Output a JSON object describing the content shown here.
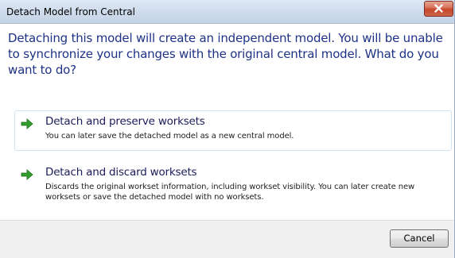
{
  "window": {
    "title": "Detach Model from Central",
    "close_icon": "close-icon",
    "close_color": "#c8472c"
  },
  "main_instruction": "Detaching this model will create an independent model. You will be unable to synchronize your changes with the original central model. What do you want to do?",
  "options": [
    {
      "icon": "green-arrow-icon",
      "title": "Detach and preserve worksets",
      "description": "You can later save the detached model as a new central model."
    },
    {
      "icon": "green-arrow-icon",
      "title": "Detach and discard worksets",
      "description": "Discards the original workset information, including workset visibility. You can later create new worksets or save the detached model with no worksets."
    }
  ],
  "footer": {
    "cancel_label": "Cancel"
  },
  "colors": {
    "instruction_text": "#1e3287",
    "arrow_green": "#2f9e2b"
  }
}
